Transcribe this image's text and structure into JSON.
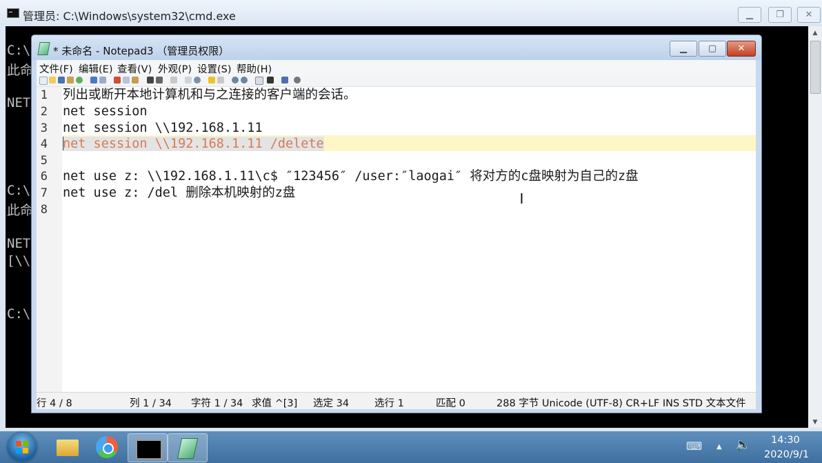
{
  "cmd": {
    "title": "管理员: C:\\Windows\\system32\\cmd.exe",
    "lines": [
      "C:\\",
      "此命",
      "NET",
      "C:\\",
      "此命",
      "NET",
      "[\\\\",
      "C:\\"
    ]
  },
  "notepad": {
    "title": "* 未命名 - Notepad3 （管理员权限）",
    "menu": [
      "文件(F)",
      "编辑(E)",
      "查看(V)",
      "外观(P)",
      "设置(S)",
      "帮助(H)"
    ],
    "line_numbers": [
      "1",
      "2",
      "3",
      "4",
      "5",
      "6",
      "7",
      "8"
    ],
    "lines": [
      "列出或断开本地计算机和与之连接的客户端的会话。",
      "net session",
      "net session \\\\192.168.1.11",
      "net session \\\\192.168.1.11 /delete",
      "",
      "net use z: \\\\192.168.1.11\\c$ ″123456″ /user:″laogai″ 将对方的c盘映射为自己的z盘",
      "net use z: /del 删除本机映射的z盘",
      ""
    ],
    "status": {
      "line": "行 4 / 8",
      "col": "列 1 / 34",
      "char": "字符 1 / 34",
      "value": "求值 ^[3]",
      "selected": "选定 34",
      "sel_lines": "选行 1",
      "match": "匹配 0",
      "info": "288 字节 Unicode (UTF-8) CR+LF INS STD 文本文件"
    }
  },
  "taskbar": {
    "time": "14:30",
    "date": "2020/9/1"
  },
  "colors": {
    "accent": "#3f6f9e",
    "current_line": "#fdf7c6",
    "selection_text": "#d57b55"
  }
}
